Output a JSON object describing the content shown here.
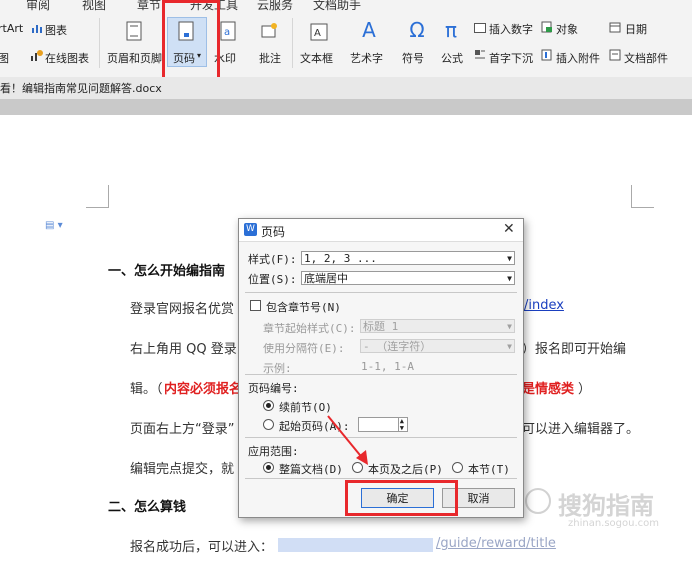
{
  "ribbon": {
    "tabs": [
      "审阅",
      "视图",
      "章节",
      "开发工具",
      "云服务",
      "文档助手"
    ],
    "left_partial_top": "rtArt",
    "chart_label": "图表",
    "left_partial_bottom": "图",
    "online_chart": "在线图表",
    "header_footer": "页眉和页脚",
    "page_number": "页码",
    "page_number_arrow": "▾",
    "watermark_partial": "水印",
    "comment": "批注",
    "textbox": "文本框",
    "wordart": "艺术字",
    "symbol": "符号",
    "formula": "公式",
    "insert_number": "插入数字",
    "object": "对象",
    "date": "日期",
    "dropcap": "首字下沉",
    "attachment": "插入附件",
    "doc_parts": "文档部件"
  },
  "doc_tab": {
    "title": "看！编辑指南常见问题解答.docx"
  },
  "document": {
    "h1": "一、怎么开始编指南",
    "p1_start": "登录官网报名优赏",
    "p1_link": "/index",
    "p2_start": "右上角用 QQ 登录",
    "p2_end": "）报名即可开始编",
    "p3_start": "辑。（",
    "p3_red": "内容必须报名",
    "p3_red_end": "是情感类",
    "p3_close": "）",
    "p4_start": "页面右上方“登录”",
    "p4_end": "可以进入编辑器了。",
    "p5_start": "编辑完点提交，就",
    "h2": "二、怎么算钱",
    "p6_start": "报名成功后，可以进入：",
    "p6_link_partial": "/guide/reward/title"
  },
  "dialog": {
    "title": "页码",
    "style_label": "样式(F):",
    "style_value": "1, 2, 3 ...",
    "position_label": "位置(S):",
    "position_value": "底端居中",
    "include_chapter": "包含章节号(N)",
    "chapter_style_label": "章节起始样式(C):",
    "chapter_style_value": "标题 1",
    "separator_label": "使用分隔符(E):",
    "separator_value": "-  （连字符）",
    "example_label": "示例:",
    "example_value": "1-1, 1-A",
    "numbering_label": "页码编号:",
    "continue_prev": "续前节(O)",
    "start_at": "起始页码(A):",
    "start_at_value": "",
    "apply_label": "应用范围:",
    "apply_whole": "整篇文档(D)",
    "apply_after": "本页及之后(P)",
    "apply_section": "本节(T)",
    "ok": "确定",
    "cancel": "取消"
  },
  "watermark": {
    "text": "搜狗指南",
    "sub": "zhinan.sogou.com"
  },
  "colors": {
    "highlight": "#e8282c",
    "accent_blue": "#2b6fd6"
  }
}
